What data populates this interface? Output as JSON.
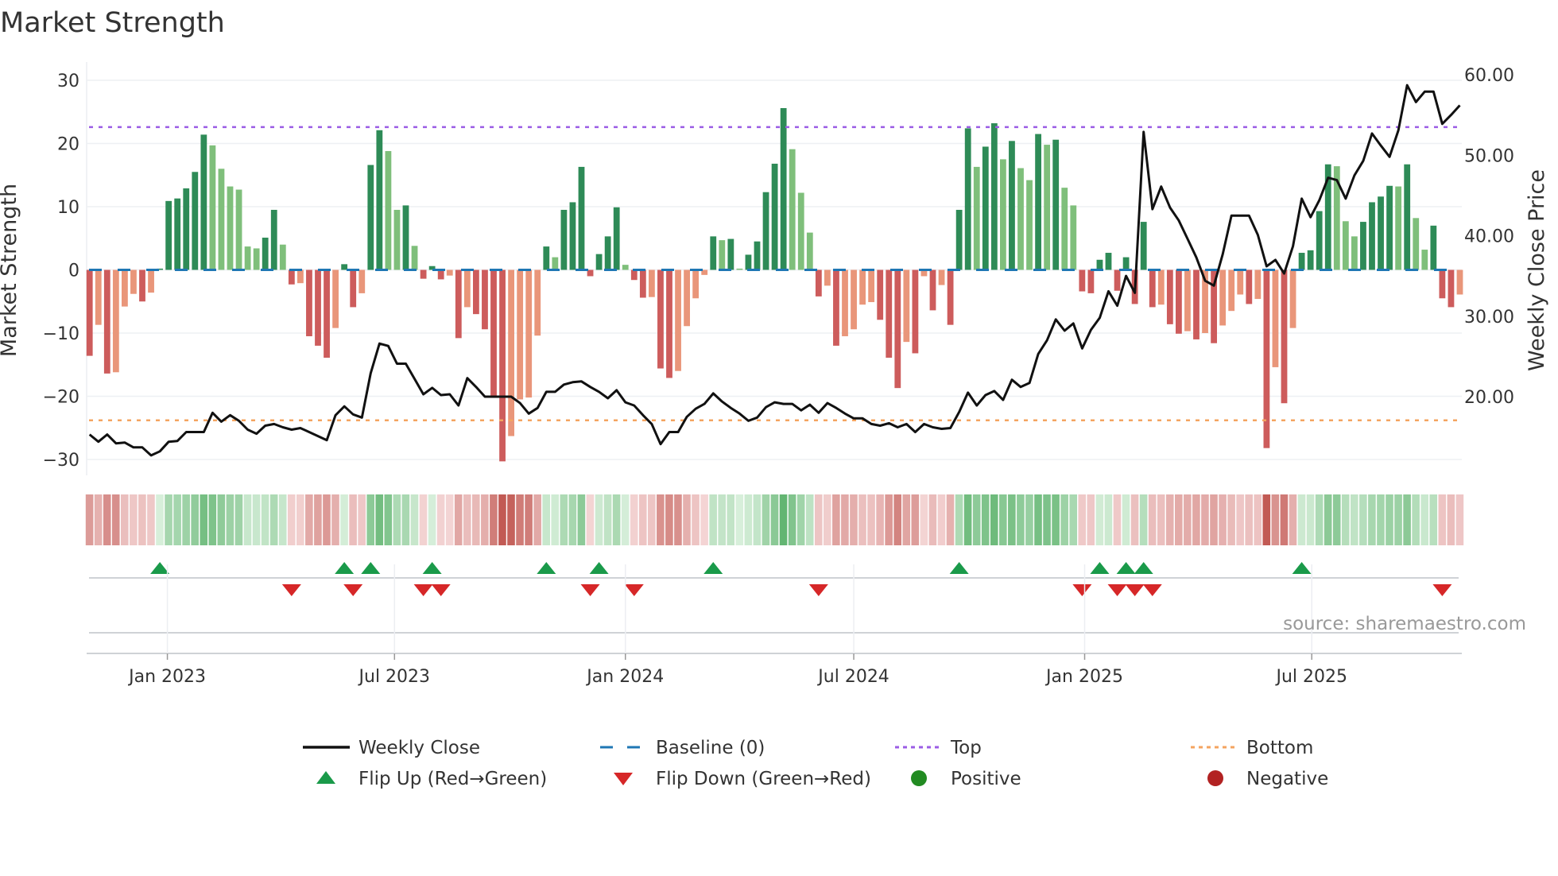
{
  "chart_data": {
    "type": "bar",
    "title": "Market Strength",
    "ylabel": "Market Strength",
    "y2label": "Weekly Close Price",
    "ylim": [
      -33,
      33
    ],
    "y2lim": [
      11,
      62
    ],
    "y_ticks": [
      30,
      20,
      10,
      0,
      -10,
      -20,
      -30
    ],
    "y_tick_labels": [
      "30",
      "20",
      "10",
      "0",
      "−10",
      "−20",
      "−30"
    ],
    "y2_ticks": [
      60,
      50,
      40,
      30,
      20
    ],
    "y2_tick_labels": [
      "60.00",
      "50.00",
      "40.00",
      "30.00",
      "20.00"
    ],
    "x_start": "2022-10-31",
    "x_step_days": 7,
    "x_ticks": [
      "2023-01-01",
      "2023-07-01",
      "2024-01-01",
      "2024-07-01",
      "2025-01-01",
      "2025-07-01"
    ],
    "x_tick_labels": [
      "Jan 2023",
      "Jul 2023",
      "Jan 2024",
      "Jul 2024",
      "Jan 2025",
      "Jul 2025"
    ],
    "grid": true,
    "top_level": 22.6,
    "bottom_level": -23.8,
    "baseline": 0,
    "series": [
      {
        "name": "Market Strength",
        "type": "bar",
        "values": [
          -13.6,
          -8.7,
          -16.4,
          -16.2,
          -5.8,
          -3.8,
          -5.0,
          -3.6,
          0.2,
          10.9,
          11.3,
          12.9,
          15.5,
          21.4,
          19.7,
          16.0,
          13.2,
          12.7,
          3.7,
          3.4,
          5.1,
          9.5,
          4.0,
          -2.3,
          -2.1,
          -10.5,
          -12.0,
          -13.9,
          -9.2,
          0.9,
          -5.9,
          -3.7,
          16.6,
          22.1,
          18.8,
          9.5,
          10.2,
          3.8,
          -1.4,
          0.6,
          -1.5,
          -0.9,
          -10.8,
          -5.9,
          -7.0,
          -9.4,
          -20.1,
          -30.3,
          -26.3,
          -20.5,
          -20.2,
          -10.4,
          3.7,
          2.0,
          9.5,
          10.7,
          16.3,
          -1.0,
          2.5,
          5.3,
          9.9,
          0.8,
          -1.6,
          -4.4,
          -4.3,
          -15.6,
          -17.1,
          -16.0,
          -8.9,
          -4.5,
          -0.8,
          5.3,
          4.7,
          4.9,
          0.2,
          2.4,
          4.5,
          12.3,
          16.8,
          25.6,
          19.1,
          12.2,
          5.9,
          -4.2,
          -2.5,
          -12.0,
          -10.5,
          -9.4,
          -5.5,
          -5.1,
          -7.9,
          -13.9,
          -18.7,
          -11.4,
          -13.2,
          -1.0,
          -6.4,
          -2.4,
          -8.7,
          9.5,
          22.4,
          16.3,
          19.5,
          23.2,
          17.5,
          20.4,
          16.1,
          14.2,
          21.5,
          19.8,
          20.6,
          13.0,
          10.2,
          -3.4,
          -3.7,
          1.6,
          2.7,
          -3.3,
          2.0,
          -5.4,
          7.6,
          -5.9,
          -5.5,
          -8.6,
          -10.1,
          -9.7,
          -11.0,
          -10.0,
          -11.6,
          -8.8,
          -6.5,
          -3.9,
          -5.4,
          -4.6,
          -28.2,
          -15.4,
          -21.1,
          -9.2,
          2.7,
          3.1,
          9.3,
          16.7,
          16.4,
          7.7,
          5.3,
          7.6,
          10.7,
          11.6,
          13.3,
          13.2,
          16.7,
          8.2,
          3.2,
          7.0,
          -4.5,
          -5.9,
          -3.9
        ]
      },
      {
        "name": "Weekly Close",
        "type": "line",
        "axis": "right",
        "values": [
          15.3,
          14.4,
          15.3,
          14.2,
          14.3,
          13.7,
          13.7,
          12.7,
          13.2,
          14.4,
          14.5,
          15.6,
          15.6,
          15.6,
          18.0,
          16.9,
          17.7,
          17.0,
          15.9,
          15.4,
          16.4,
          16.6,
          16.2,
          15.9,
          16.1,
          15.6,
          15.1,
          14.6,
          17.7,
          18.8,
          17.8,
          17.4,
          22.9,
          26.6,
          26.3,
          24.1,
          24.1,
          22.2,
          20.3,
          21.1,
          20.2,
          20.3,
          18.9,
          22.3,
          21.2,
          20.0,
          20.0,
          20.0,
          20.0,
          19.2,
          17.9,
          18.6,
          20.6,
          20.6,
          21.5,
          21.8,
          21.9,
          21.2,
          20.6,
          19.8,
          20.8,
          19.3,
          18.9,
          17.7,
          16.6,
          14.1,
          15.6,
          15.6,
          17.5,
          18.5,
          19.1,
          20.4,
          19.4,
          18.6,
          17.9,
          17.0,
          17.4,
          18.7,
          19.3,
          19.1,
          19.1,
          18.3,
          19.0,
          18.0,
          19.2,
          18.6,
          17.9,
          17.3,
          17.3,
          16.6,
          16.4,
          16.7,
          16.2,
          16.6,
          15.6,
          16.6,
          16.2,
          16.0,
          16.1,
          18.1,
          20.5,
          18.9,
          20.2,
          20.7,
          19.6,
          22.1,
          21.2,
          21.7,
          25.3,
          27.0,
          29.6,
          28.2,
          29.1,
          26.0,
          28.3,
          29.8,
          33.1,
          31.3,
          35.0,
          32.9,
          52.9,
          43.3,
          46.1,
          43.5,
          41.9,
          39.6,
          37.3,
          34.4,
          33.8,
          37.7,
          42.5,
          42.5,
          42.5,
          40.1,
          36.2,
          37.0,
          35.3,
          38.7,
          44.6,
          42.3,
          44.4,
          47.2,
          46.9,
          44.6,
          47.5,
          49.3,
          52.7,
          51.2,
          49.8,
          53.1,
          58.7,
          56.6,
          57.9,
          57.9,
          53.9,
          55.0,
          56.2
        ]
      }
    ],
    "flip_up_weeks": [
      9,
      30,
      33,
      40,
      53,
      59,
      72,
      100,
      116,
      119,
      121,
      139
    ],
    "flip_down_weeks": [
      24,
      31,
      39,
      41,
      58,
      63,
      84,
      114,
      118,
      120,
      122,
      155
    ],
    "colors": {
      "green_strong": "#2e8b57",
      "green_weak": "#7fbf7b",
      "red_strong": "#cd5c5c",
      "red_weak": "#e9967a",
      "close": "#111111",
      "baseline": "#1f77b4",
      "top": "#9b5de5",
      "bottom": "#f4a460",
      "flip_up": "#1a9a4a",
      "flip_down": "#d62728",
      "positive": "#228b22",
      "negative": "#b22222"
    },
    "legend": {
      "placement": "bottom-center",
      "items": [
        {
          "label": "Weekly Close",
          "kind": "line"
        },
        {
          "label": "Baseline (0)",
          "kind": "dash"
        },
        {
          "label": "Top",
          "kind": "dot-purple"
        },
        {
          "label": "Bottom",
          "kind": "dot-orange"
        },
        {
          "label": "Flip Up (Red→Green)",
          "kind": "tri-up"
        },
        {
          "label": "Flip Down (Green→Red)",
          "kind": "tri-down"
        },
        {
          "label": "Positive",
          "kind": "circle-green"
        },
        {
          "label": "Negative",
          "kind": "circle-red"
        }
      ]
    },
    "source": "source: sharemaestro.com"
  }
}
